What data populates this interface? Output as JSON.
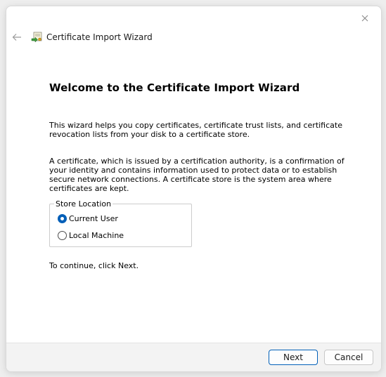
{
  "window": {
    "title": "Certificate Import Wizard",
    "close_icon": "close-icon",
    "back_icon": "back-arrow-icon",
    "title_icon": "certificate-icon"
  },
  "content": {
    "heading": "Welcome to the Certificate Import Wizard",
    "paragraph1": "This wizard helps you copy certificates, certificate trust lists, and certificate revocation lists from your disk to a certificate store.",
    "paragraph2": "A certificate, which is issued by a certification authority, is a confirmation of your identity and contains information used to protect data or to establish secure network connections. A certificate store is the system area where certificates are kept.",
    "store_location": {
      "legend": "Store Location",
      "options": [
        {
          "label": "Current User",
          "selected": true
        },
        {
          "label": "Local Machine",
          "selected": false
        }
      ]
    },
    "continue_text": "To continue, click Next."
  },
  "footer": {
    "next_label": "Next",
    "cancel_label": "Cancel"
  },
  "colors": {
    "accent": "#005fb8",
    "footer_bg": "#f3f3f3"
  }
}
